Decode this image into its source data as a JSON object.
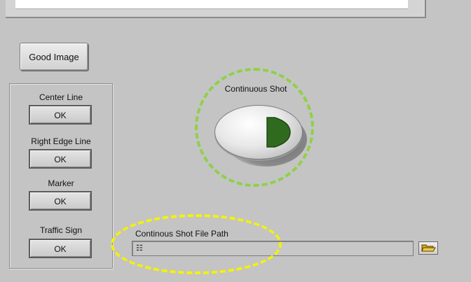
{
  "good_image_button": {
    "label": "Good Image"
  },
  "indicators": [
    {
      "label": "Center Line",
      "value": "OK"
    },
    {
      "label": "Right Edge Line",
      "value": "OK"
    },
    {
      "label": "Marker",
      "value": "OK"
    },
    {
      "label": "Traffic Sign",
      "value": "OK"
    }
  ],
  "continuous_shot": {
    "label": "Continuous Shot"
  },
  "file_path": {
    "label": "Continous Shot File Path",
    "value": ""
  },
  "colors": {
    "background": "#c4c4c4",
    "continuous_highlight": "#8fd04a",
    "path_highlight": "#f2f20a",
    "play_icon": "#2f6a1f"
  }
}
